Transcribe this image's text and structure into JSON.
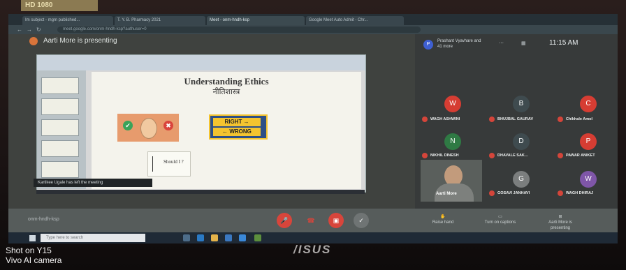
{
  "sticker": {
    "text": "HD 1080"
  },
  "browser": {
    "tabs": [
      {
        "label": "Im subject - mgm published..."
      },
      {
        "label": "T. Y. B. Pharmacy 2021"
      },
      {
        "label": "Meet - onm-hndh-ksp"
      },
      {
        "label": "Google Meet Auto Admit - Chr..."
      }
    ],
    "url": "meet.google.com/onm-hndh-ksp?authuser=0"
  },
  "meet": {
    "presenting_text": "Aarti More is presenting",
    "participants_info": "Prashant Vyavhare and 41 more",
    "time": "11:15 AM",
    "notification": "Kartikee Ugale has left the meeting",
    "meeting_code": "onm-hndh-ksp",
    "self_name": "Aarti More",
    "bottom_actions": [
      "Raise hand",
      "Turn on captions",
      "Aarti More is presenting"
    ],
    "tiles": [
      {
        "initial": "W",
        "name": "WAGH ASHWINI",
        "color": "#d63d33"
      },
      {
        "initial": "B",
        "name": "BHUJBAL GAURAV",
        "color": "#3f4b4f"
      },
      {
        "initial": "C",
        "name": "Chikhale Amol",
        "color": "#d63d33"
      },
      {
        "initial": "N",
        "name": "NIKHIL DINESH",
        "color": "#2f7a44"
      },
      {
        "initial": "D",
        "name": "DHAVALE SAK...",
        "color": "#3f4b4f"
      },
      {
        "initial": "P",
        "name": "PAWAR ANIKET",
        "color": "#d63d33"
      },
      {
        "initial": "G",
        "name": "GOSAVI JANHAVI",
        "color": "#7b7e7e"
      },
      {
        "initial": "W",
        "name": "WAGH DHIRAJ",
        "color": "#7f56a8"
      }
    ]
  },
  "slide": {
    "title": "Understanding Ethics",
    "subtitle": "नीतिशास्त्र",
    "sign_right": "RIGHT →",
    "sign_wrong": "← WRONG",
    "should_text": "Should I ?"
  },
  "taskbar": {
    "search_placeholder": "Type here to search"
  },
  "brand": {
    "logo": "/ISUS"
  },
  "watermark": {
    "line1": "Shot on Y15",
    "line2": "Vivo AI camera"
  }
}
